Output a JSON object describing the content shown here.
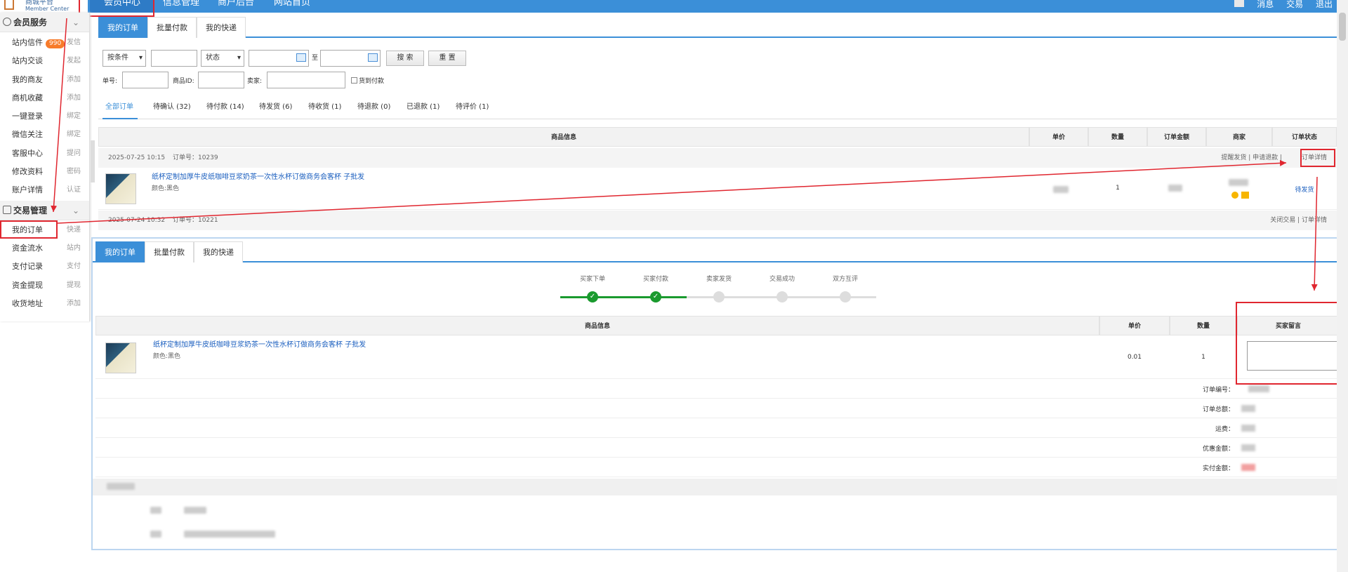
{
  "header": {
    "logo_title": "商城平台",
    "logo_sub": "Member Center",
    "nav": [
      "会员中心",
      "信息管理",
      "商户后台",
      "网站首页"
    ],
    "right": [
      "消息",
      "交易",
      "退出"
    ]
  },
  "sidebar": {
    "section1": "会员服务",
    "items1": [
      {
        "label": "站内信件",
        "badge": "990",
        "action": "发信"
      },
      {
        "label": "站内交谈",
        "action": "发起"
      },
      {
        "label": "我的商友",
        "action": "添加"
      },
      {
        "label": "商机收藏",
        "action": "添加"
      },
      {
        "label": "一键登录",
        "action": "绑定"
      },
      {
        "label": "微信关注",
        "action": "绑定"
      },
      {
        "label": "客服中心",
        "action": "提问"
      },
      {
        "label": "修改资料",
        "action": "密码"
      },
      {
        "label": "账户详情",
        "action": "认证"
      }
    ],
    "section2": "交易管理",
    "items2": [
      {
        "label": "我的订单",
        "action": "快递"
      },
      {
        "label": "资金流水",
        "action": "站内"
      },
      {
        "label": "支付记录",
        "action": "支付"
      },
      {
        "label": "资金提现",
        "action": "提现"
      },
      {
        "label": "收货地址",
        "action": "添加"
      }
    ]
  },
  "orders": {
    "tabs": [
      "我的订单",
      "批量付款",
      "我的快递"
    ],
    "filter": {
      "condition": "按条件",
      "status": "状态",
      "to": "至",
      "search": "搜 索",
      "reset": "重 置",
      "order_no_label": "单号:",
      "product_id_label": "商品ID:",
      "seller_label": "卖家:",
      "cod_label": "货到付款"
    },
    "status_tabs": [
      "全部订单",
      "待确认 (32)",
      "待付款 (14)",
      "待发货 (6)",
      "待收货 (1)",
      "待退款 (0)",
      "已退款 (1)",
      "待评价 (1)"
    ],
    "columns": [
      "商品信息",
      "单价",
      "数量",
      "订单金额",
      "商家",
      "订单状态"
    ],
    "order1": {
      "date": "2025-07-25 10:15",
      "order_no": "订单号：10239",
      "actions": "提醒发货 | 申请退款 |",
      "detail": "订单详情",
      "product": "纸杯定制加厚牛皮纸咖啡豆浆奶茶一次性水杯订做商务会客杯 子批发",
      "spec": "颜色:黑色",
      "qty": "1",
      "status": "待发货"
    },
    "order2": {
      "date": "2025-07-24 10:32",
      "order_no": "订单号：10221",
      "actions": "关闭交易 | 订单详情"
    }
  },
  "detail": {
    "tabs": [
      "我的订单",
      "批量付款",
      "我的快递"
    ],
    "steps": [
      "买家下单",
      "买家付款",
      "卖家发货",
      "交易成功",
      "双方互评"
    ],
    "columns": [
      "商品信息",
      "单价",
      "数量",
      "买家留言"
    ],
    "product": "纸杯定制加厚牛皮纸咖啡豆浆奶茶一次性水杯订做商务会客杯 子批发",
    "spec": "颜色:黑色",
    "price": "0.01",
    "qty": "1",
    "summary": [
      "订单编号：",
      "订单总额：",
      "运费：",
      "优惠金额：",
      "实付金额："
    ],
    "thumb_text": "全新升级 免费设计"
  },
  "colors": {
    "accent": "#3b8fd8",
    "annotation": "#e0262f",
    "progress": "#1a9a2e"
  }
}
